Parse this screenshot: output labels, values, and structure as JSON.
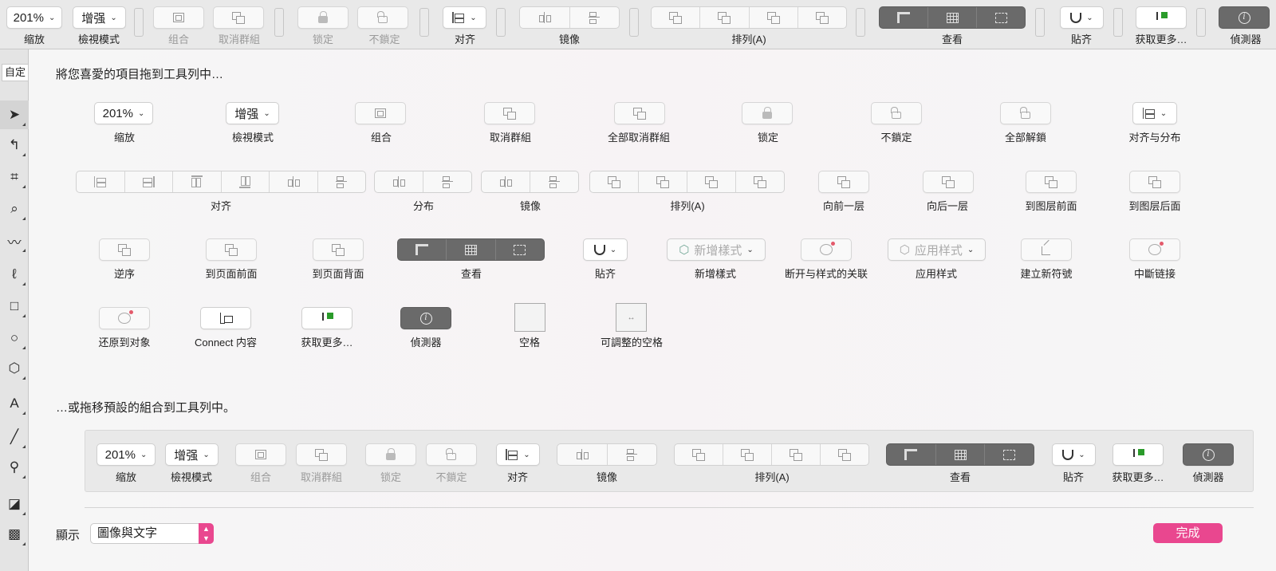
{
  "toolbar": {
    "zoom": "201%",
    "view": "增强",
    "labels": {
      "zoom": "缩放",
      "view": "檢視模式",
      "group": "组合",
      "ungroup": "取消群組",
      "lock": "锁定",
      "unlock": "不鎖定",
      "align": "对齐",
      "mirror": "镜像",
      "arrange": "排列(A)",
      "view2": "查看",
      "snap": "貼齐",
      "getmore": "获取更多…",
      "inspector": "偵測器"
    }
  },
  "sidebar": {
    "custom": "自定"
  },
  "sheet": {
    "prompt": "將您喜愛的項目拖到工具列中…",
    "row1": [
      "缩放",
      "檢視模式",
      "组合",
      "取消群組",
      "全部取消群組",
      "锁定",
      "不鎖定",
      "全部解鎖",
      "对齐与分布"
    ],
    "row2": [
      "对齐",
      "分布",
      "镜像",
      "排列(A)",
      "向前一层",
      "向后一层",
      "到图层前面",
      "到图层后面"
    ],
    "row3": [
      "逆序",
      "到页面前面",
      "到页面背面",
      "查看",
      "貼齐",
      "新增樣式",
      "断开与样式的关联",
      "应用样式",
      "建立新符號",
      "中斷链接"
    ],
    "row4": [
      "还原到对象",
      "Connect 内容",
      "获取更多…",
      "偵測器",
      "空格",
      "可調整的空格"
    ],
    "newstyle": "新增樣式",
    "applystyle": "应用样式",
    "zoom": "201%",
    "view": "增强",
    "defaultPrompt": "…或拖移預設的組合到工具列中。",
    "defaults": {
      "zoom": "201%",
      "view": "增强",
      "labels": [
        "缩放",
        "檢視模式",
        "组合",
        "取消群組",
        "锁定",
        "不鎖定",
        "对齐",
        "镜像",
        "排列(A)",
        "查看",
        "貼齐",
        "获取更多…",
        "偵測器"
      ]
    },
    "showLabel": "顯示",
    "showValue": "圖像與文字",
    "done": "完成"
  },
  "colors": {
    "done": "#e9478f"
  }
}
